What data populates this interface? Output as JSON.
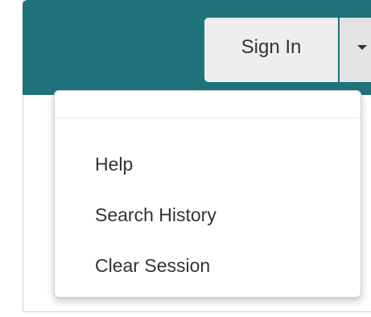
{
  "header": {
    "sign_in_label": "Sign In",
    "toggle_icon": "caret-down-icon"
  },
  "dropdown": {
    "items": [
      {
        "label": "Help"
      },
      {
        "label": "Search History"
      },
      {
        "label": "Clear Session"
      }
    ]
  },
  "colors": {
    "header_bg": "#1f737a",
    "button_bg": "#eeeeee",
    "text": "#333333"
  }
}
